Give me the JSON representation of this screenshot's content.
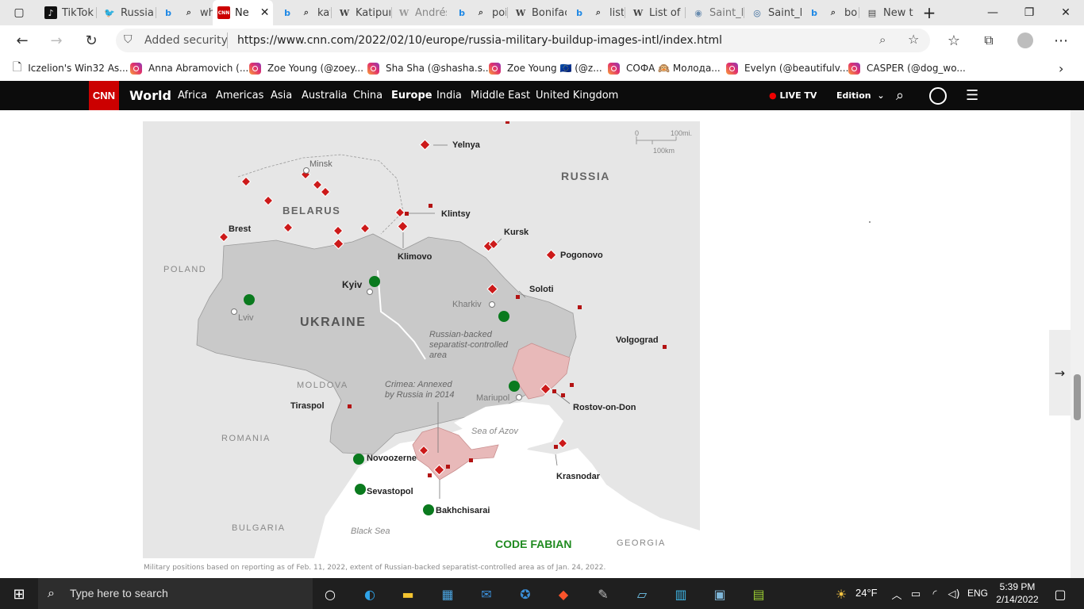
{
  "browser": {
    "tabs": [
      {
        "title": "",
        "icon": "tab-actions-icon"
      },
      {
        "title": "TikTok",
        "icon": "tiktok-icon"
      },
      {
        "title": "Russia",
        "icon": "twitter-icon"
      },
      {
        "title": "",
        "icon": "bing-icon"
      },
      {
        "title": "wh",
        "icon": "search-icon"
      },
      {
        "title": "Ne",
        "icon": "cnn-icon",
        "active": true
      },
      {
        "title": "",
        "icon": "bing-icon"
      },
      {
        "title": "kat",
        "icon": "search-icon"
      },
      {
        "title": "Katipur",
        "icon": "wikipedia-icon"
      },
      {
        "title": "Andrés",
        "icon": "wikipedia-icon"
      },
      {
        "title": "",
        "icon": "bing-icon"
      },
      {
        "title": "poi",
        "icon": "search-icon"
      },
      {
        "title": "Bonifac",
        "icon": "wikipedia-icon"
      },
      {
        "title": "",
        "icon": "bing-icon"
      },
      {
        "title": "list",
        "icon": "search-icon"
      },
      {
        "title": "List of",
        "icon": "wikipedia-icon"
      },
      {
        "title": "Saint_F",
        "icon": "wiki-commons-icon"
      },
      {
        "title": "Saint_F",
        "icon": "wikimedia-icon"
      },
      {
        "title": "",
        "icon": "bing-icon"
      },
      {
        "title": "bo",
        "icon": "search-icon"
      },
      {
        "title": "New ta",
        "icon": "new-tab-icon"
      }
    ],
    "security_label": "Added security",
    "url": "https://www.cnn.com/2022/02/10/europe/russia-military-buildup-images-intl/index.html",
    "favorites": [
      {
        "label": "Iczelion's Win32 As...",
        "icon": "page-icon"
      },
      {
        "label": "Anna Abramovich (...",
        "icon": "instagram-icon"
      },
      {
        "label": "Zoe Young (@zoey...",
        "icon": "instagram-icon"
      },
      {
        "label": "Sha Sha (@shasha.s...",
        "icon": "instagram-icon"
      },
      {
        "label": "Zoe Young 🇪🇺 (@z...",
        "icon": "instagram-icon"
      },
      {
        "label": "СОФА 🙉 Молода...",
        "icon": "instagram-icon"
      },
      {
        "label": "Evelyn (@beautifulv...",
        "icon": "instagram-icon"
      },
      {
        "label": "CASPER (@dog_wo...",
        "icon": "instagram-icon"
      }
    ]
  },
  "cnn": {
    "logo": "CNN",
    "section": "World",
    "nav": [
      "Africa",
      "Americas",
      "Asia",
      "Australia",
      "China",
      "Europe",
      "India",
      "Middle East",
      "United Kingdom"
    ],
    "active_nav": "Europe",
    "live_tv": "LIVE TV",
    "edition": "Edition"
  },
  "map": {
    "scale": {
      "zero": "0",
      "mi": "100mi.",
      "km": "100km"
    },
    "countries": [
      "RUSSIA",
      "BELARUS",
      "UKRAINE",
      "POLAND",
      "MOLDOVA",
      "ROMANIA",
      "BULGARIA",
      "GEORGIA"
    ],
    "cities": [
      "Yelnya",
      "Minsk",
      "Klintsy",
      "Brest",
      "Klimovo",
      "Kursk",
      "Pogonovo",
      "Kyiv",
      "Soloti",
      "Kharkiv",
      "Lviv",
      "Volgograd",
      "Mariupol",
      "Rostov-on-Don",
      "Tiraspol",
      "Novoozerne",
      "Sevastopol",
      "Bakhchisarai",
      "Krasnodar"
    ],
    "water": [
      "Sea of Azov",
      "Black Sea"
    ],
    "annotations": {
      "separatist": [
        "Russian-backed",
        "separatist-controlled",
        "area"
      ],
      "crimea": [
        "Crimea: Annexed",
        "by Russia in 2014"
      ]
    },
    "watermark": "CODE FABIAN",
    "colors": {
      "red": "#cc1a1a",
      "green": "#0a7a1e",
      "ukraine": "#c9c9c9",
      "land": "#e6e6e6",
      "sea": "#ffffff",
      "separatist": "#e8b9b9"
    }
  },
  "caption": "Military positions based on reporting as of Feb. 11, 2022, extent of Russian-backed separatist-controlled area as of Jan. 24, 2022.",
  "taskbar": {
    "search_placeholder": "Type here to search",
    "weather": "24°F",
    "language": "ENG",
    "time": "5:39 PM",
    "date": "2/14/2022"
  }
}
